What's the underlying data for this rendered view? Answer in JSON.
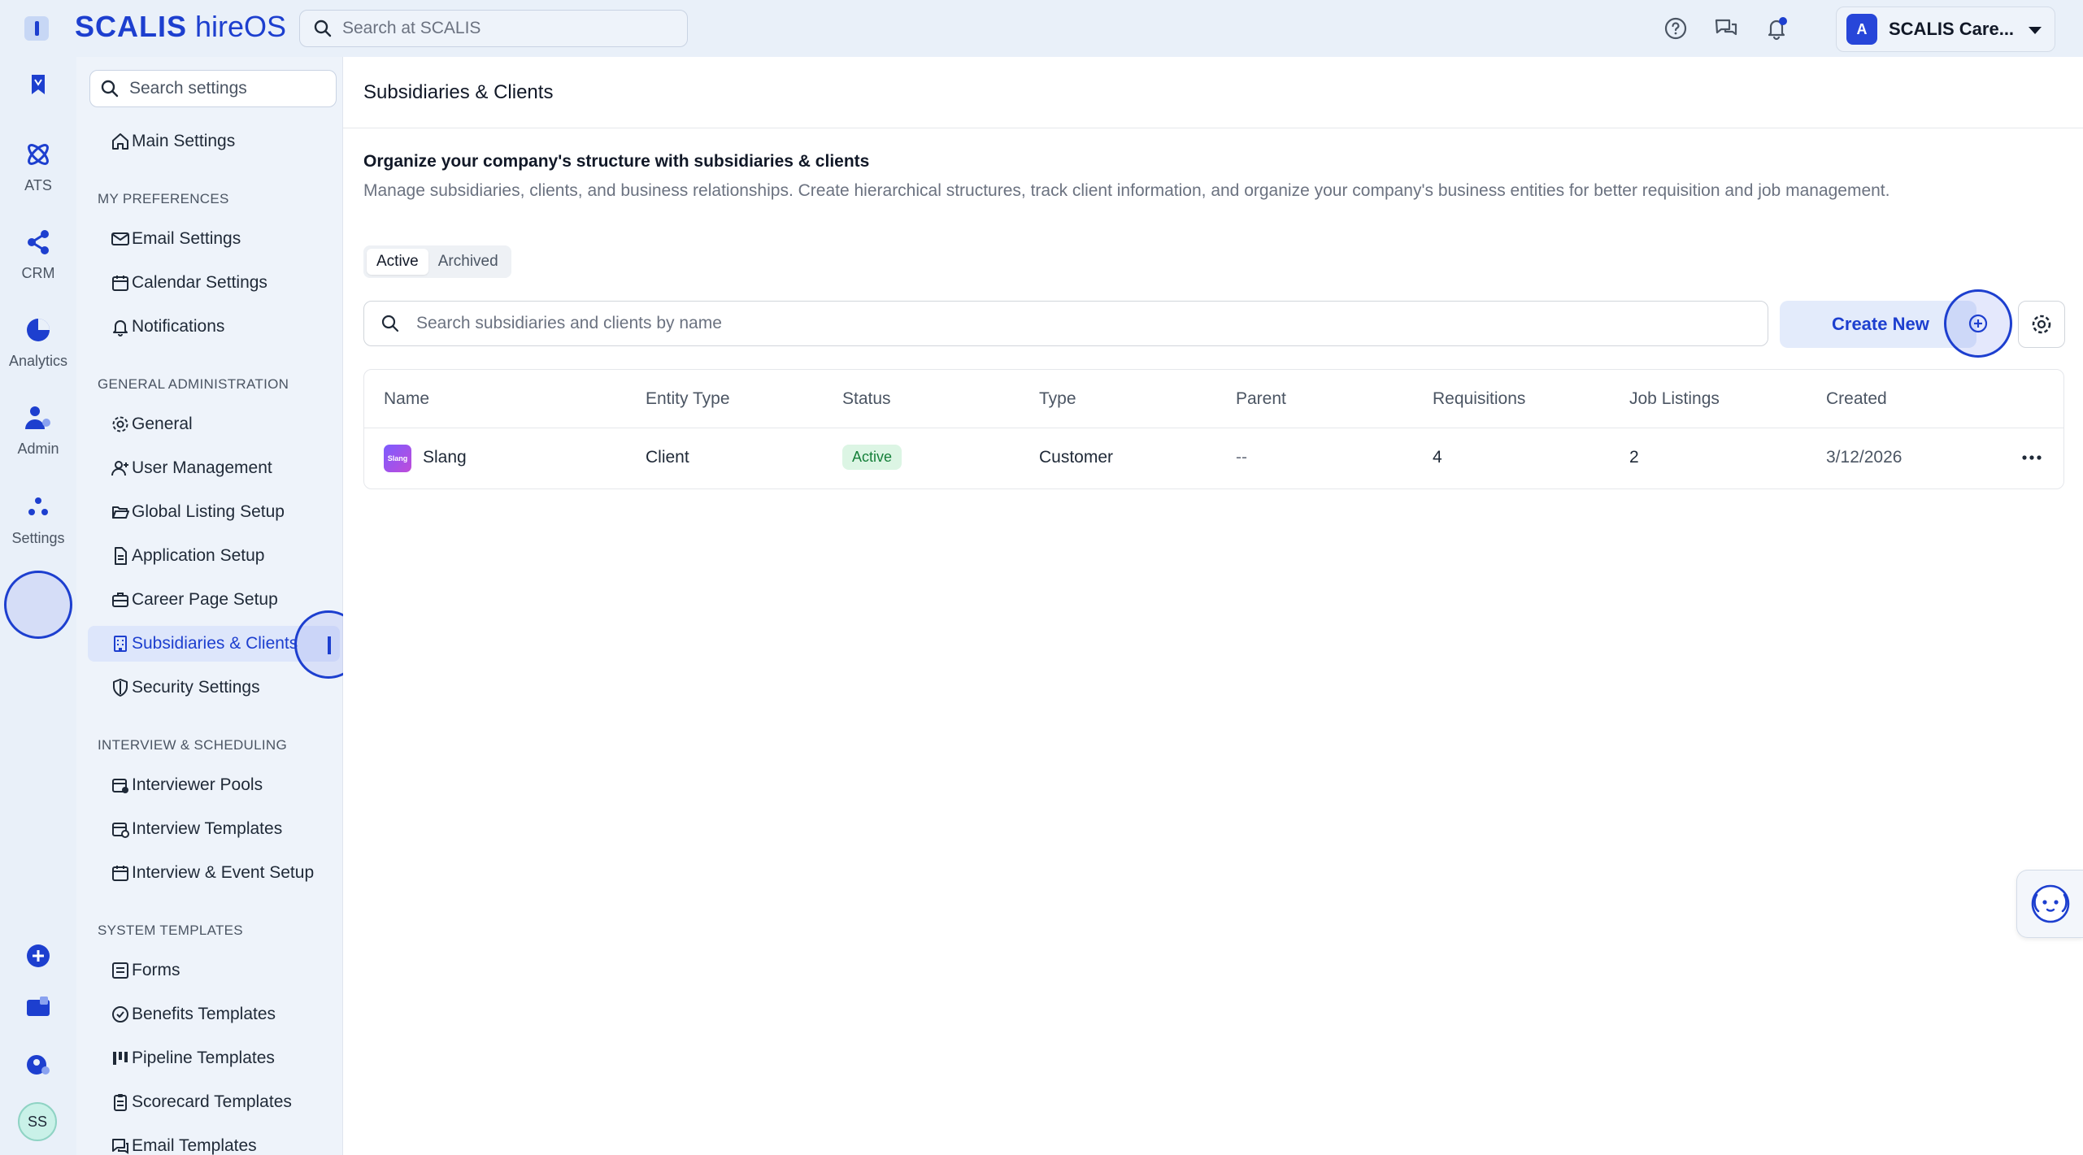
{
  "app": {
    "brand_name": "SCALIS",
    "brand_sub": "hireOS",
    "search_placeholder": "Search at SCALIS",
    "account_name": "SCALIS Care...",
    "account_logo": "A",
    "accent_color": "#1d3fcf"
  },
  "rail": {
    "items": [
      {
        "label": ""
      },
      {
        "label": "ATS"
      },
      {
        "label": "CRM"
      },
      {
        "label": "Analytics"
      },
      {
        "label": "Admin"
      },
      {
        "label": "Settings"
      }
    ],
    "avatar_initials": "SS"
  },
  "sidebar": {
    "search_placeholder": "Search settings",
    "main_settings": "Main Settings",
    "sections": {
      "preferences": "MY PREFERENCES",
      "admin": "GENERAL ADMINISTRATION",
      "interview": "INTERVIEW & SCHEDULING",
      "templates": "SYSTEM TEMPLATES"
    },
    "items": {
      "email_settings": "Email Settings",
      "calendar_settings": "Calendar Settings",
      "notifications": "Notifications",
      "general": "General",
      "user_management": "User Management",
      "global_listing_setup": "Global Listing Setup",
      "application_setup": "Application Setup",
      "career_page_setup": "Career Page Setup",
      "subsidiaries_clients": "Subsidiaries & Clients",
      "security_settings": "Security Settings",
      "interviewer_pools": "Interviewer Pools",
      "interview_templates": "Interview Templates",
      "interview_event_setup": "Interview & Event Setup",
      "forms": "Forms",
      "benefits_templates": "Benefits Templates",
      "pipeline_templates": "Pipeline Templates",
      "scorecard_templates": "Scorecard Templates",
      "email_templates": "Email Templates"
    }
  },
  "main": {
    "page_title": "Subsidiaries & Clients",
    "intro_title": "Organize your company's structure with subsidiaries & clients",
    "intro_desc": "Manage subsidiaries, clients, and business relationships. Create hierarchical structures, track client information, and organize your company's business entities for better requisition and job management.",
    "tabs": [
      "Active",
      "Archived"
    ],
    "search_placeholder": "Search subsidiaries and clients by name",
    "create_label": "Create New",
    "columns": [
      "Name",
      "Entity Type",
      "Status",
      "Type",
      "Parent",
      "Requisitions",
      "Job Listings",
      "Created"
    ],
    "rows": [
      {
        "logo_text": "Slang",
        "name": "Slang",
        "entity_type": "Client",
        "status": "Active",
        "type": "Customer",
        "parent": "--",
        "requisitions": "4",
        "job_listings": "2",
        "created": "3/12/2026"
      }
    ]
  }
}
